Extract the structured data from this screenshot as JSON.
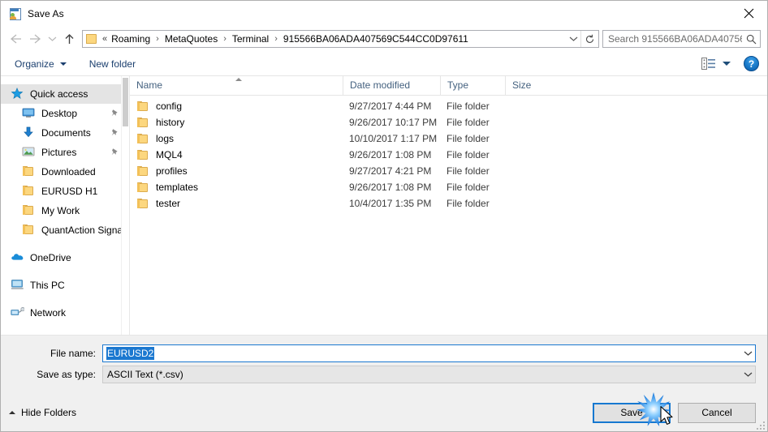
{
  "window": {
    "title": "Save As",
    "icon": "save-as-app-icon",
    "close_label": "✕"
  },
  "nav": {
    "back_icon": "arrow-left-icon",
    "forward_icon": "arrow-right-icon",
    "recent_icon": "chevron-down-icon",
    "up_icon": "arrow-up-icon",
    "address": {
      "folder_icon": "folder-icon",
      "overflow": "«",
      "crumbs": [
        "Roaming",
        "MetaQuotes",
        "Terminal",
        "915566BA06ADA407569C544CC0D97611"
      ],
      "separator": "›",
      "dropdown_icon": "chevron-down-icon",
      "refresh_icon": "refresh-icon"
    },
    "search": {
      "placeholder": "Search 915566BA06ADA40756...",
      "icon": "search-icon"
    }
  },
  "toolbar": {
    "organize_label": "Organize",
    "new_folder_label": "New folder",
    "view_icon": "view-layout-icon",
    "view_dropdown_icon": "chevron-down-icon",
    "help_label": "?"
  },
  "sidebar": {
    "items": [
      {
        "label": "Quick access",
        "icon": "star-icon",
        "selected": true,
        "indent": false,
        "pinned": false
      },
      {
        "label": "Desktop",
        "icon": "monitor-icon",
        "selected": false,
        "indent": true,
        "pinned": true
      },
      {
        "label": "Documents",
        "icon": "download-arrow-icon",
        "selected": false,
        "indent": true,
        "pinned": true
      },
      {
        "label": "Pictures",
        "icon": "picture-icon",
        "selected": false,
        "indent": true,
        "pinned": true
      },
      {
        "label": "Downloaded",
        "icon": "folder-icon",
        "selected": false,
        "indent": true,
        "pinned": false
      },
      {
        "label": "EURUSD H1",
        "icon": "folder-icon",
        "selected": false,
        "indent": true,
        "pinned": false
      },
      {
        "label": "My Work",
        "icon": "folder-icon",
        "selected": false,
        "indent": true,
        "pinned": false
      },
      {
        "label": "QuantAction Signal",
        "icon": "folder-icon",
        "selected": false,
        "indent": true,
        "pinned": false
      }
    ],
    "roots": [
      {
        "label": "OneDrive",
        "icon": "cloud-icon"
      },
      {
        "label": "This PC",
        "icon": "computer-icon"
      },
      {
        "label": "Network",
        "icon": "network-icon"
      }
    ]
  },
  "filelist": {
    "columns": [
      {
        "key": "name",
        "label": "Name",
        "sorted": "asc"
      },
      {
        "key": "date",
        "label": "Date modified",
        "sorted": ""
      },
      {
        "key": "type",
        "label": "Type",
        "sorted": ""
      },
      {
        "key": "size",
        "label": "Size",
        "sorted": ""
      }
    ],
    "rows": [
      {
        "name": "config",
        "date": "9/27/2017 4:44 PM",
        "type": "File folder",
        "size": "",
        "icon": "folder-icon"
      },
      {
        "name": "history",
        "date": "9/26/2017 10:17 PM",
        "type": "File folder",
        "size": "",
        "icon": "folder-icon"
      },
      {
        "name": "logs",
        "date": "10/10/2017 1:17 PM",
        "type": "File folder",
        "size": "",
        "icon": "folder-icon"
      },
      {
        "name": "MQL4",
        "date": "9/26/2017 1:08 PM",
        "type": "File folder",
        "size": "",
        "icon": "folder-icon"
      },
      {
        "name": "profiles",
        "date": "9/27/2017 4:21 PM",
        "type": "File folder",
        "size": "",
        "icon": "folder-icon"
      },
      {
        "name": "templates",
        "date": "9/26/2017 1:08 PM",
        "type": "File folder",
        "size": "",
        "icon": "folder-icon"
      },
      {
        "name": "tester",
        "date": "10/4/2017 1:35 PM",
        "type": "File folder",
        "size": "",
        "icon": "folder-icon"
      }
    ]
  },
  "form": {
    "filename_label": "File name:",
    "filename_value": "EURUSD2",
    "filetype_label": "Save as type:",
    "filetype_value": "ASCII Text (*.csv)",
    "dropdown_icon": "chevron-down-icon"
  },
  "footer": {
    "hide_folders_label": "Hide Folders",
    "hide_folders_icon": "chevron-up-icon",
    "save_label": "Save",
    "cancel_label": "Cancel",
    "resize_grip_icon": "resize-grip-icon",
    "cursor_icon": "mouse-pointer-icon",
    "click_burst_icon": "click-burst-icon"
  },
  "colors": {
    "accent": "#1678d0",
    "selection": "#1b78d0",
    "folder_yellow": "#fcd77f",
    "header_text": "#44617f",
    "toolbar_text": "#1b3f6e",
    "form_bg": "#f0f0f0"
  }
}
